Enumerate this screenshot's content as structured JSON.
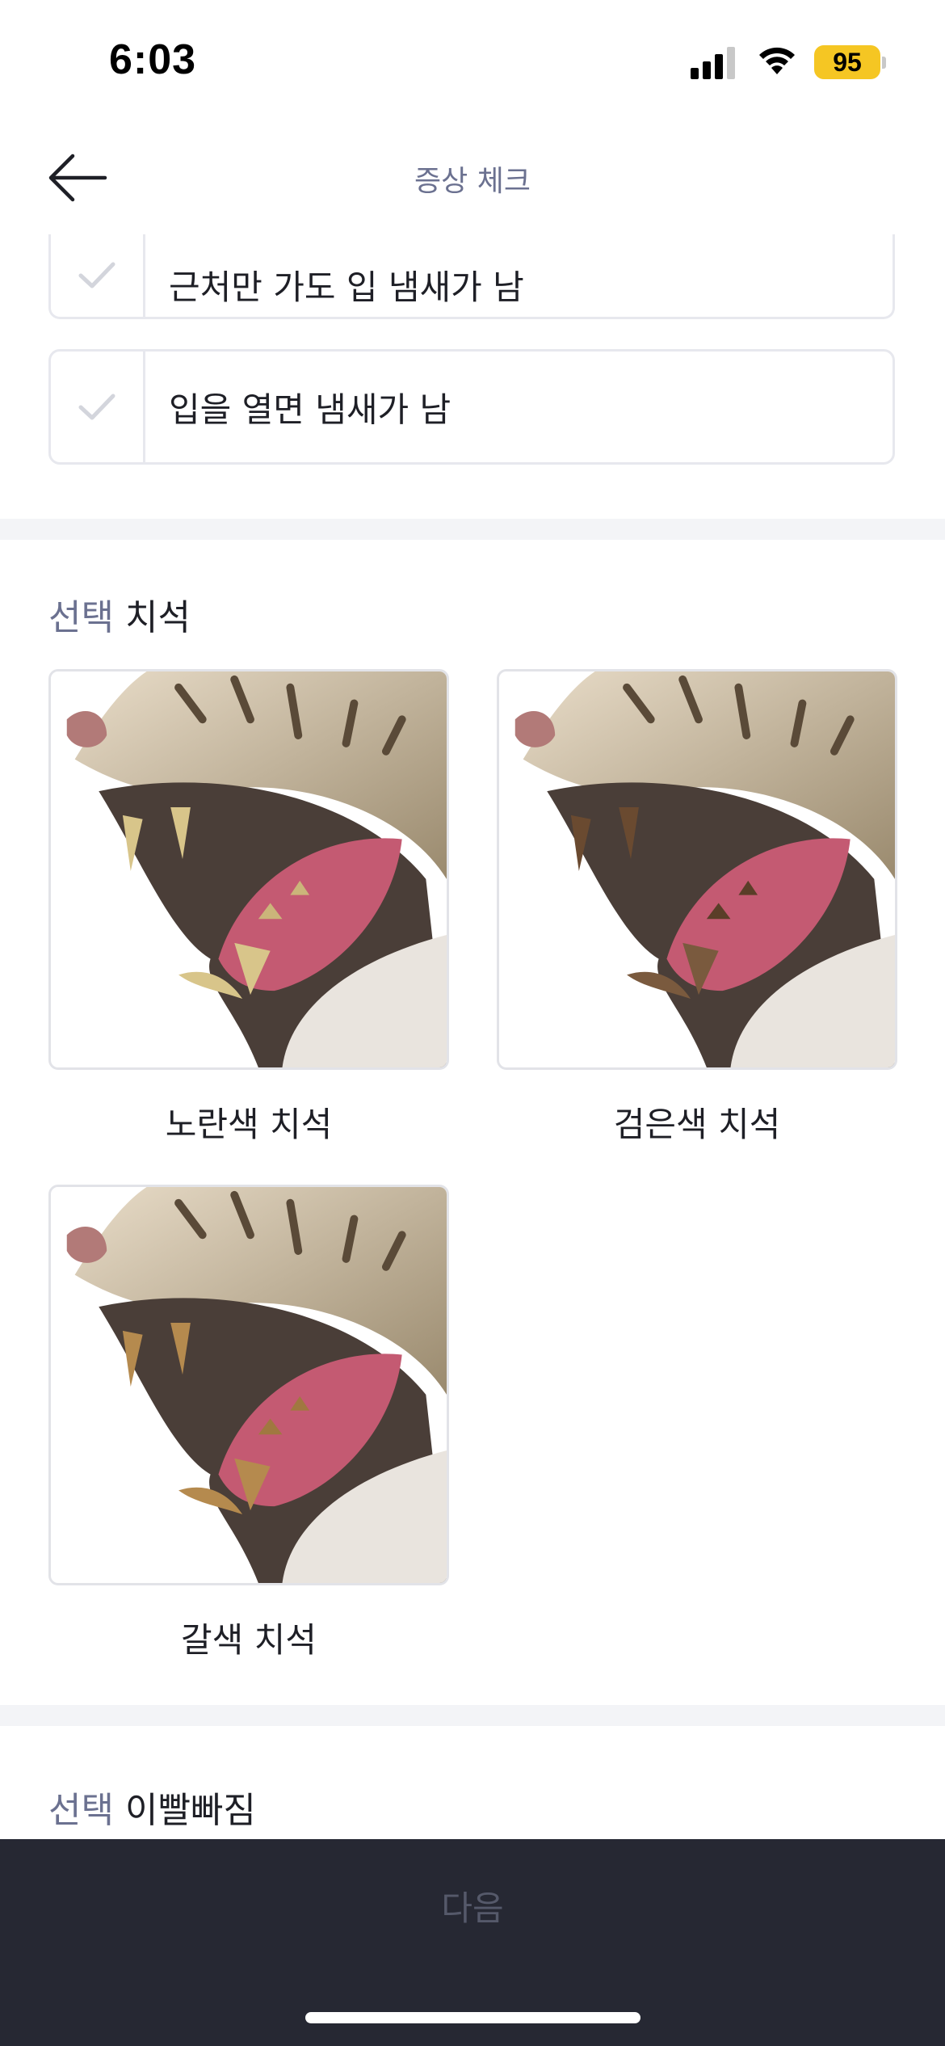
{
  "status_bar": {
    "time": "6:03",
    "battery": "95"
  },
  "nav": {
    "title": "증상 체크"
  },
  "options": [
    {
      "label": "근처만 가도 입 냄새가 남"
    },
    {
      "label": "입을 열면 냄새가 남"
    }
  ],
  "sections": [
    {
      "tag": "선택",
      "title": "치석",
      "cards": [
        {
          "label": "노란색 치석",
          "tooth_color": "#d8c58a"
        },
        {
          "label": "검은색 치석",
          "tooth_color": "#6a4a30"
        },
        {
          "label": "갈색 치석",
          "tooth_color": "#b58a4e"
        }
      ]
    },
    {
      "tag": "선택",
      "title": "이빨빠짐"
    }
  ],
  "footer": {
    "next_label": "다음"
  },
  "colors": {
    "accent": "#6b7190",
    "bottom_bar": "#262833",
    "battery": "#f5c623"
  }
}
